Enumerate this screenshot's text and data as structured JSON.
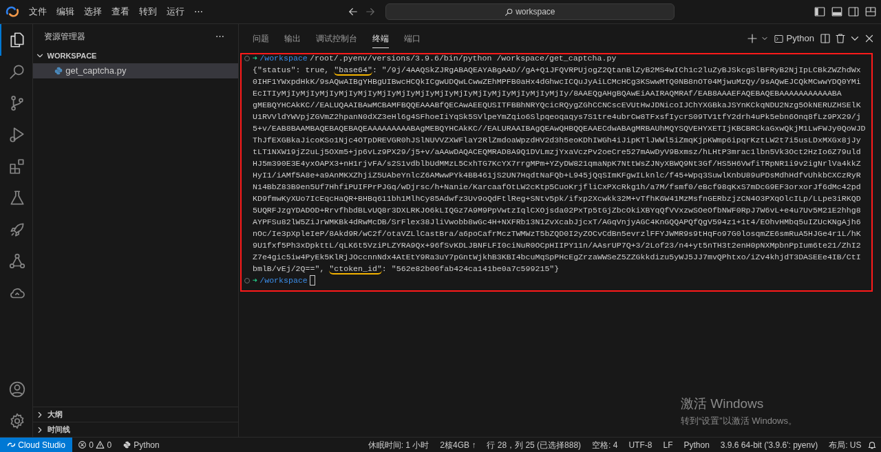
{
  "menu_bar": {
    "items": [
      "文件",
      "编辑",
      "选择",
      "查看",
      "转到",
      "运行",
      "⋯"
    ]
  },
  "command_center": {
    "label": "workspace"
  },
  "activity_bar": {
    "items": [
      {
        "kind": "files",
        "selected": true
      },
      {
        "kind": "search",
        "selected": false
      },
      {
        "kind": "source-control",
        "selected": false
      },
      {
        "kind": "run",
        "selected": false
      },
      {
        "kind": "extensions",
        "selected": false
      },
      {
        "kind": "flask",
        "selected": false
      },
      {
        "kind": "rocket",
        "selected": false
      },
      {
        "kind": "graph",
        "selected": false
      },
      {
        "kind": "cloud",
        "selected": false
      }
    ],
    "bottom_items": [
      {
        "kind": "account",
        "selected": false
      },
      {
        "kind": "settings",
        "selected": false
      }
    ]
  },
  "sidebar": {
    "title": "资源管理器",
    "more": "⋯",
    "sections": [
      {
        "title": "WORKSPACE",
        "expanded": true,
        "children": [
          {
            "name": "get_captcha.py",
            "selected": true
          }
        ]
      },
      {
        "title": "大纲",
        "expanded": false
      },
      {
        "title": "时间线",
        "expanded": false
      }
    ]
  },
  "panel": {
    "tabs": [
      {
        "label": "问题",
        "selected": false
      },
      {
        "label": "输出",
        "selected": false
      },
      {
        "label": "调试控制台",
        "selected": false
      },
      {
        "label": "终端",
        "selected": true
      },
      {
        "label": "端口",
        "selected": false
      }
    ],
    "terminal_name": "Python",
    "terminal": {
      "highlighted": true,
      "command_line": {
        "arrow": "➜",
        "path": "/workspace",
        "command": "/root/.pyenv/versions/3.9.6/bin/python /workspace/get_captcha.py"
      },
      "output_lines": [
        [
          {
            "text": "{\"status\": true, ",
            "underlined": false
          },
          {
            "text": "\"base64\"",
            "underlined": true
          },
          {
            "text": ": \"/9j/4AAQSkZJRgABAQEAYABgAAD//gA+Q1JFQVRPUjogZ2QtanBlZyB2MS4wICh1c2luZyBJSkcgSlBFRyB2NjIpLCBkZWZhdWx",
            "underlined": false
          }
        ],
        [
          {
            "text": "0IHF1YWxpdHkK/9sAQwAIBgYHBgUIBwcHCQkICgwUDQwLCwwZEhMPFB0aHx4dGhwcICQuJyAiLCMcHCg3KSwwMTQ0NB8nOT04MjwuMzQy/9sAQwEJCQkMCwwYDQ0YMi",
            "underlined": false
          }
        ],
        [
          {
            "text": "EcITIyMjIyMjIyMjIyMjIyMjIyMjIyMjIyMjIyMjIyMjIyMjIyMjIyMjIyMjIyMjIy/8AAEQgAHgBQAwEiAAIRAQMRAf/EAB8AAAEFAQEBAQEBAAAAAAAAAAABA",
            "underlined": false
          }
        ],
        [
          {
            "text": "gMEBQYHCAkKC//EALUQAAIBAwMCBAMFBQQEAAABfQECAwAEEQUSITFBBhNRYQcicRQygZGhCCNCscEVUtHwJDNicoIJChYXGBkaJSYnKCkqNDU2Nzg5OkNERUZHSElK",
            "underlined": false
          }
        ],
        [
          {
            "text": "U1RVVldYWVpjZGVmZ2hpanN0dXZ3eHl6g4SFhoeIiYqSk5SVlpeYmZqio6Slpqeoqaqys7S1tre4ubrCw8TFxsfIycrS09TV1tfY2drh4uPk5ebn6Onq8fLz9PX29/j",
            "underlined": false
          }
        ],
        [
          {
            "text": "5+v/EAB8BAAMBAQEBAQEBAQEAAAAAAAAABAgMEBQYHCAkKC//EALURAAIBAgQEAwQHBQQEAAECdwABAgMRBAUhMQYSQVEHYXETIjKBCBRCkaGxwQkjM1LwFWJy0QoWJD",
            "underlined": false
          }
        ],
        [
          {
            "text": "ThJfEXGBkaJicoKSo1Njc4OTpDREVGR0hJSlNUVVZXWFlaY2RlZmdoaWpzdHV2d3h5eoKDhIWGh4iJipKTlJWWl5iZmqKjpKWmp6ipqrKztLW2t7i5usLDxMXGx8jJy",
            "underlined": false
          }
        ],
        [
          {
            "text": "tLT1NXW19jZ2uLj5OXm5+jp6vLz9PX29/j5+v/aAAwDAQACEQMRAD8A9Q1DVLmzjYxaVczPv2oeCre527mAwDyV9Bxmsz/hLHtP3mrac1lbn5Vk3Oct2HzIo6Z79uld",
            "underlined": false
          }
        ],
        [
          {
            "text": "HJ5m390E3E4yxOAPX3+nH1rjvFA/s2S1vdblbUdMMzL5CxhTG7KcYX7rrgMPm+YZyDW821qmaNpK7NttWsZJNyXBWQ9Nt3Gf/HS5H6VwfiTRpNR1i9v2igNrlVa4kkZ",
            "underlined": false
          }
        ],
        [
          {
            "text": "HyI1/iAMf5A8e+a9AnMKXZhjiZ5UAbeYnlcZ6AMwwPYk4BB461jS2UN7HqdtNaFQb+L945jQqSImKFgwILknlc/f45+Wpq3SuwlKnbU89uPDsMdhHdfvUhkbCXCzRyR",
            "underlined": false
          }
        ],
        [
          {
            "text": "N14BbZ83B9en5Uf7HhfiPUIFPrPJGq/wDjrsc/h+Nanie/KarcaafOtLW2cKtp5CuoKrjfliCxPXcRkg1h/a7M/fsmf0/eBcf98qKxS7mDcG9EF3orxorJf6dMc42pd",
            "underlined": false
          }
        ],
        [
          {
            "text": "KD9fmwKyXUo7IcEqcHaQR+BHBq611bh1MlhCy85Adwfz3Uv9oQdFtlReg+SNtv5pk/ifxp2Xcwkk32M+vTfhK6W41MzMsfnGERbzjzCN4O3PXqOlcILp/LLpe3iRKQD",
            "underlined": false
          }
        ],
        [
          {
            "text": "5UQRFJzgYDADOD+RrvfhbdBLvUQ8r3DXLRKJO6kLIQGz7A9M9PpVwtzIqlCXOjsda02PxTp5tGjZbcOkiXBYqQfVVxzwSOeOfbNWF0RpJ7W6vL+e4u7Uv5M21E2hhg8",
            "underlined": false
          }
        ],
        [
          {
            "text": "AYPFSu82lW5ZiJrWMKBk4dRwMcDB/SrFlex38JliVwobb8wGc4H+NXFRb13N1ZvXcabJjcxT/AGqVnjyAGC4KnGQQAPQfQgV594z1+1t4/EOhvHMbq5uIZUcKNgAjh6",
            "underlined": false
          }
        ],
        [
          {
            "text": "nOc/Ie3pXpleIeP/8Akd9R/wC2f/otaVZLlCastBra/a6poCafrMczTWMWzT5bZQD0I2yZOCvCdBn5evrzlFFYJWMR9s9tHqFo97G0losqmZE6smRuA5HJGe4r1L/hK",
            "underlined": false
          }
        ],
        [
          {
            "text": "9U1fxf5Ph3xDpkttL/qLK6t5VziPLZYRA9Qx+96fSvKDLJBNFLFI0ciNuR0OCpHIIPY11n/AAsrUP7Q+3/2Lof23/n4+yt5nTH3t2enH0pNXMpbnPpIum6te21/ZhI2",
            "underlined": false
          }
        ],
        [
          {
            "text": "Z7e4gic5iw4PyEk5KlRjJOccnnNdx4AtEtY9Ra3uY7pGntWjkhB3KBI4bcuMqSpPHcEgZrzaWWSeZ5ZZGkkdizu5yWJ5JJ7mvQPhtxo/iZv4khjdT3DASEEe4IB/CtI",
            "underlined": false
          }
        ],
        [
          {
            "text": "bmlB/vEj/2Q==\", ",
            "underlined": false
          },
          {
            "text": "\"ctoken_id\"",
            "underlined": true
          },
          {
            "text": ": \"562e82b06fab424ca141be0a7c599215\"}",
            "underlined": false
          }
        ]
      ],
      "prompt": {
        "arrow": "➜",
        "path": "/workspace"
      }
    }
  },
  "status_bar": {
    "remote": "Cloud Studio",
    "errors": "0",
    "warnings": "0",
    "language": "Python",
    "items": [
      "休眠时间: 1 小时",
      "2核4GB ↑",
      "行 28，列 25 (已选择888)",
      "空格: 4",
      "UTF-8",
      "LF",
      "Python",
      "3.9.6 64-bit ('3.9.6': pyenv)",
      "布局: US"
    ]
  },
  "os_notice": {
    "title": "激活 Windows",
    "text": "转到“设置”以激活 Windows。"
  }
}
